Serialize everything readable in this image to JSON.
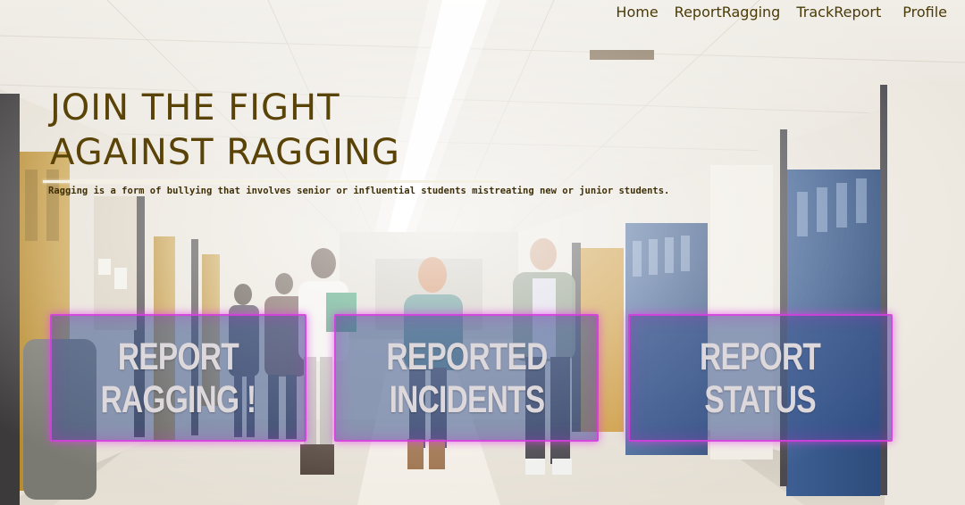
{
  "nav": {
    "home": "Home",
    "report_ragging": "ReportRagging",
    "track_report": "TrackReport",
    "profile": "Profile"
  },
  "hero": {
    "title": "JOIN THE FIGHT\nAGAINST RAGGING",
    "subtitle": "Ragging is a form of bullying that involves senior or influential students mistreating new or junior students."
  },
  "cards": [
    {
      "label": "REPORT\nRAGGING !"
    },
    {
      "label": "REPORTED\nINCIDENTS"
    },
    {
      "label": "REPORT\nSTATUS"
    }
  ],
  "colors": {
    "title": "#5a4306",
    "nav_text": "#4a3a07",
    "card_fill": "#38548c",
    "card_glow": "#e03ce4",
    "card_text": "#ddd8db"
  }
}
